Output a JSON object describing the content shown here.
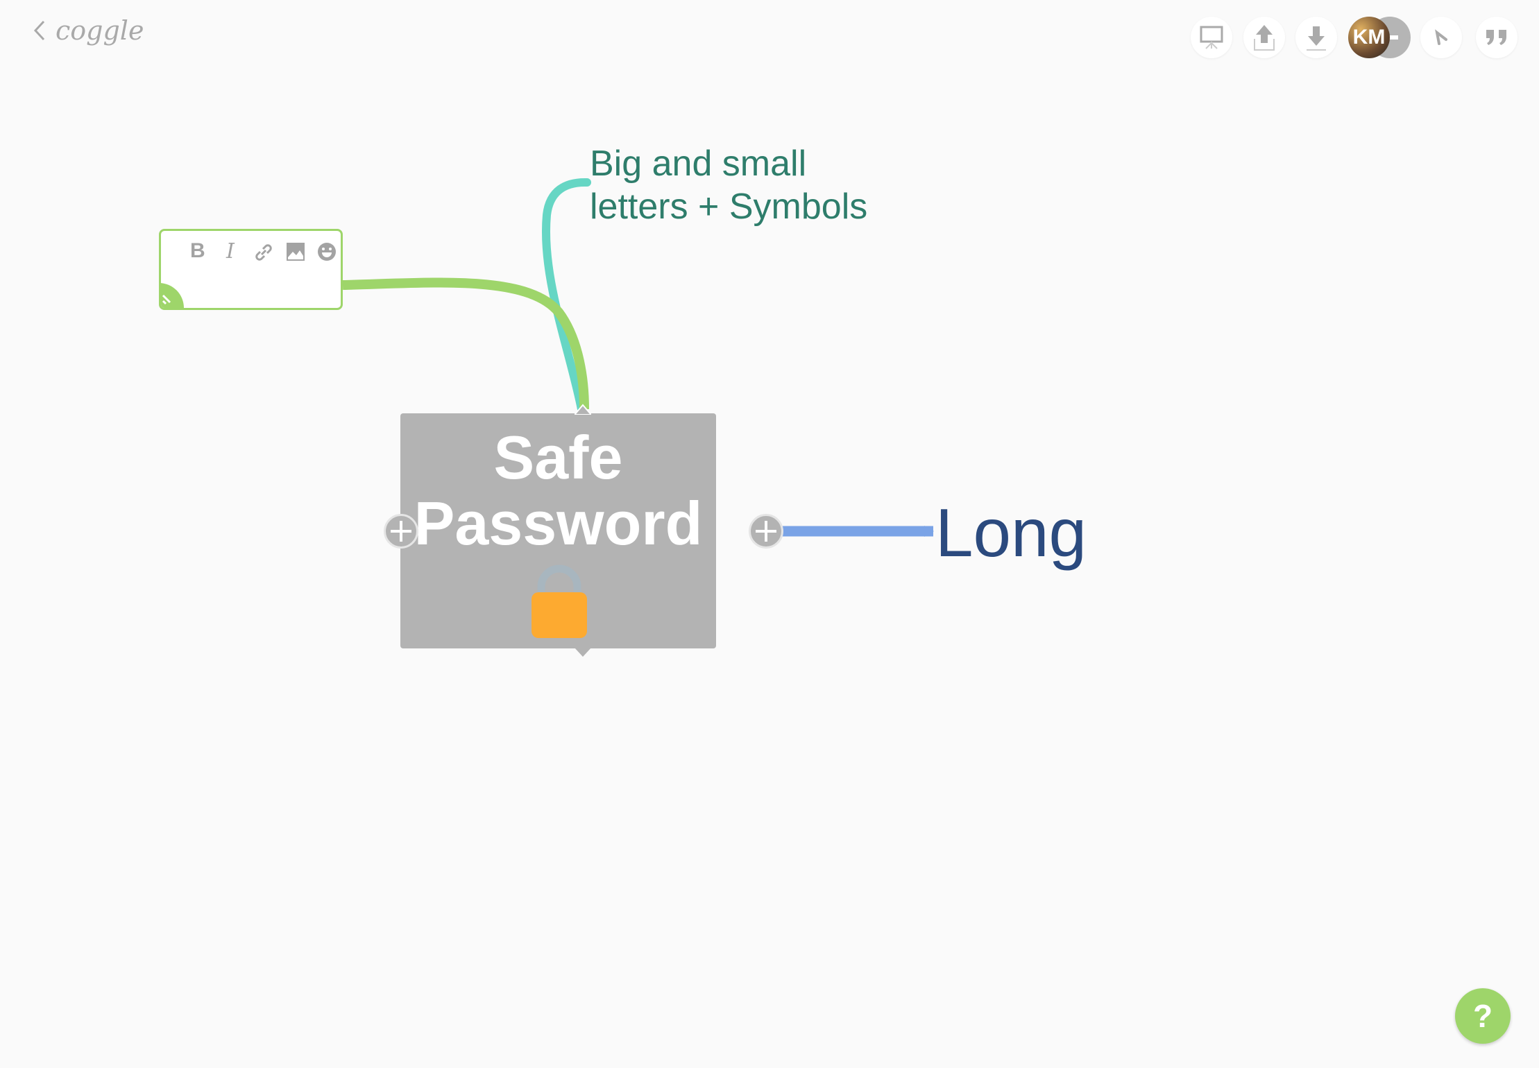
{
  "app": {
    "logo_text": "coggle"
  },
  "toolbar": {
    "buttons": [
      {
        "name": "present",
        "icon": "presentation-icon"
      },
      {
        "name": "share",
        "icon": "upload-icon"
      },
      {
        "name": "download",
        "icon": "download-icon"
      },
      {
        "name": "pointer",
        "icon": "cursor-icon"
      },
      {
        "name": "comments",
        "icon": "quote-icon"
      }
    ],
    "user_initials": "KM"
  },
  "note_editor": {
    "tools": [
      "B",
      "I",
      "link",
      "image",
      "emoji"
    ],
    "color": "#9ed56a"
  },
  "mindmap": {
    "root": {
      "label_line1": "Safe",
      "label_line2": "Password",
      "icon": "lock-icon",
      "fill": "#b3b3b3"
    },
    "branches": [
      {
        "label_line1": "Big and small",
        "label_line2": "letters + Symbols",
        "color": "#2e7d6b",
        "line_color": "#66d6c4"
      },
      {
        "label": "Long",
        "color": "#2b4a7e",
        "line_color": "#7aa3e6"
      }
    ]
  },
  "help": {
    "label": "?"
  }
}
